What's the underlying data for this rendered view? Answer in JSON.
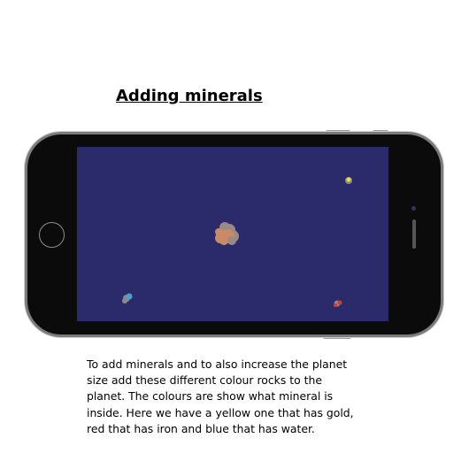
{
  "title": "Adding minerals",
  "caption_lines": [
    "To add minerals and to also increase the planet",
    "size add these different colour rocks to the",
    "planet. The colours are show what mineral is",
    "inside. Here we have a yellow one that has gold,",
    "red that has iron and blue that has water."
  ],
  "colors": {
    "screen_background": "#2b2b6c",
    "planet_rock": "#c98a68",
    "planet_shade": "#9a8a86",
    "gold_rock": "#e8e030",
    "iron_rock": "#d23a3a",
    "water_rock": "#4aa0d0",
    "rock_gray": "#8a8a8a"
  }
}
